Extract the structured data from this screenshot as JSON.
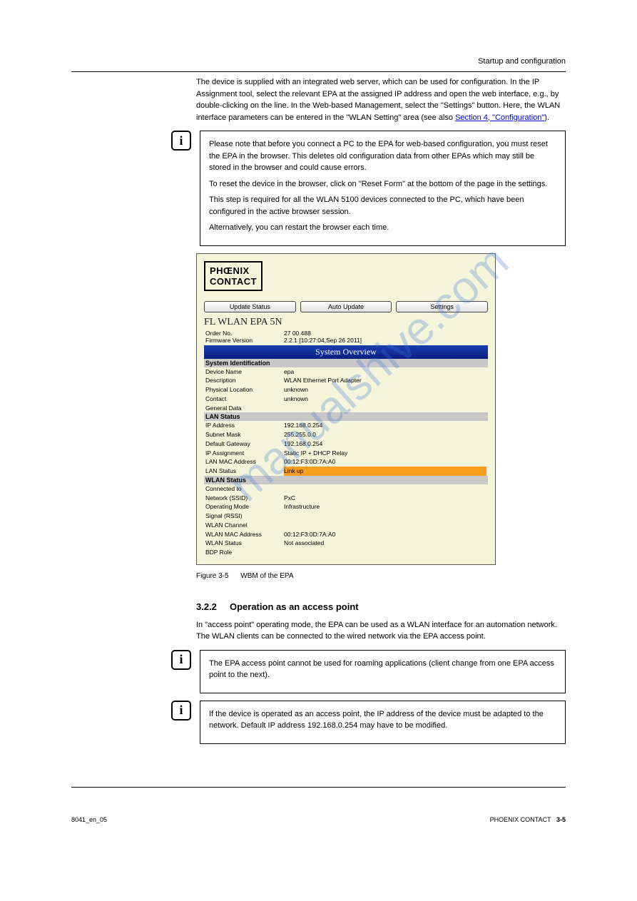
{
  "page": {
    "header_title": "Startup and configuration",
    "intro": "The device is supplied with an integrated web server, which can be used for configuration. In the IP Assignment tool, select the relevant EPA at the assigned IP address and open the web interface, e.g., by double-clicking on the line. In the Web-based Management, select the \"Settings\" button. Here, the WLAN interface parameters can be entered in the \"WLAN Setting\" area (see also ",
    "intro_link": "Section 4, \"Configuration\"",
    "intro_tail": ")."
  },
  "note1": {
    "p1": "Please note that before you connect a PC to the EPA for web-based configuration, you must reset the EPA in the browser. This deletes old configuration data from other EPAs which may still be stored in the browser and could cause errors.",
    "p2": "To reset the device in the browser, click on \"Reset Form\" at the bottom of the page in the settings.",
    "p3": "This step is required for all the WLAN 5100 devices connected to the PC, which have been configured in the active browser session.",
    "p4": "Alternatively, you can restart the browser each time."
  },
  "screenshot": {
    "logo_top": "PHŒNIX",
    "logo_bot": "CONTACT",
    "buttons": {
      "update": "Update Status",
      "auto": "Auto Update",
      "settings": "Settings"
    },
    "product": "FL WLAN EPA 5N",
    "order_no_k": "Order No.",
    "order_no_v": "27 00 488",
    "fw_k": "Firmware Version",
    "fw_v": "2.2.1 [10:27:04,Sep 26 2011]",
    "overview": "System Overview",
    "sys_ident": "System Identification",
    "dev_name_k": "Device Name",
    "dev_name_v": "epa",
    "desc_k": "Description",
    "desc_v": "WLAN Ethernet Port Adapter",
    "loc_k": "Physical Location",
    "loc_v": "unknown",
    "contact_k": "Contact",
    "contact_v": "unknown",
    "gen_k": "General Data",
    "lan_status": "LAN Status",
    "ip_k": "IP Address",
    "ip_v": "192.168.0.254",
    "mask_k": "Subnet Mask",
    "mask_v": "255.255.0.0",
    "gw_k": "Default Gateway",
    "gw_v": "192.168.0.254",
    "ipas_k": "IP Assignment",
    "ipas_v": "Static IP + DHCP Relay",
    "lanmac_k": "LAN MAC Address",
    "lanmac_v": "00:12:F3:0D:7A:A0",
    "lanst_k": "LAN Status",
    "lanst_v": "Link up",
    "wlan_status": "WLAN Status",
    "ssid_k1": "Connected to",
    "ssid_k2": "Network (SSID)",
    "ssid_v": "PxC",
    "op_k": "Operating Mode",
    "op_v": "Infrastructure",
    "rssi_k": "Signal (RSSI)",
    "ch_k": "WLAN Channel",
    "wlanmac_k": "WLAN MAC Address",
    "wlanmac_v": "00:12:F3:0D:7A:A0",
    "wlanst_k": "WLAN Status",
    "wlanst_v": "Not associated",
    "bdp_k": "BDP Role"
  },
  "caption": {
    "label": "Figure 3-5",
    "text": "WBM of the EPA"
  },
  "section": {
    "num": "3.2.2",
    "title": "Operation as an access point"
  },
  "ap_text": "In \"access point\" operating mode, the EPA can be used as a WLAN interface for an automation network. The WLAN clients can be connected to the wired network via the EPA access point.",
  "note2": "The EPA access point cannot be used for roaming applications (client change from one EPA access point to the next).",
  "note3": "If the device is operated as an access point, the IP address of the device must be adapted to the network. Default IP address 192.168.0.254 may have to be modified.",
  "footer": {
    "left": "8041_en_05",
    "right_brand": "PHOENIX CONTACT",
    "right_page": "3-5"
  },
  "watermark": "manualshive.com"
}
